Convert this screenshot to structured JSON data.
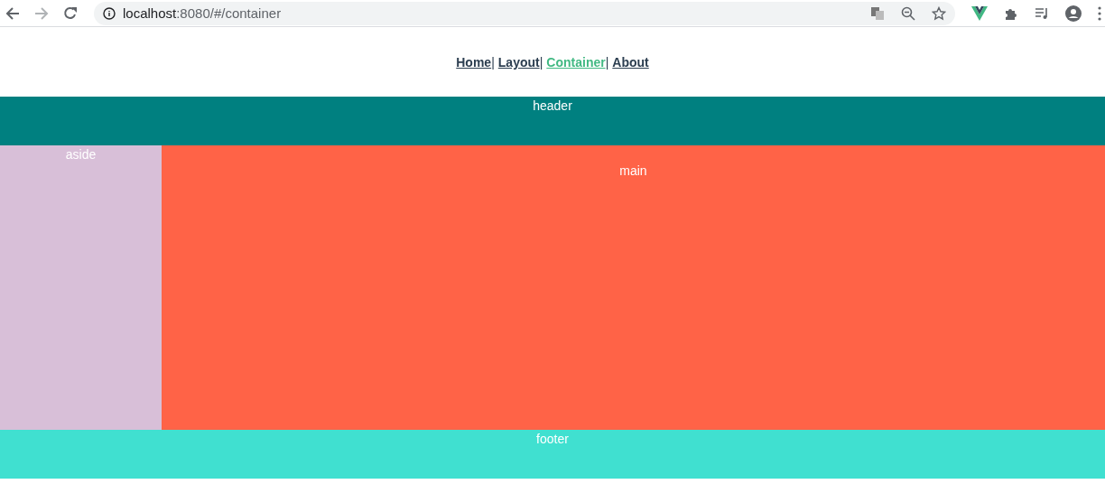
{
  "browser": {
    "url_host": "localhost",
    "url_path": ":8080/#/container"
  },
  "nav": [
    {
      "label": "Home",
      "selected": false,
      "separator": "|"
    },
    {
      "label": "Layout",
      "selected": false,
      "separator": "|"
    },
    {
      "label": "Container",
      "selected": true,
      "separator": "|"
    },
    {
      "label": "About",
      "selected": false
    }
  ],
  "header": {
    "label": "header"
  },
  "aside": {
    "label": "aside"
  },
  "main": {
    "label": "main"
  },
  "footer": {
    "label": "footer"
  }
}
